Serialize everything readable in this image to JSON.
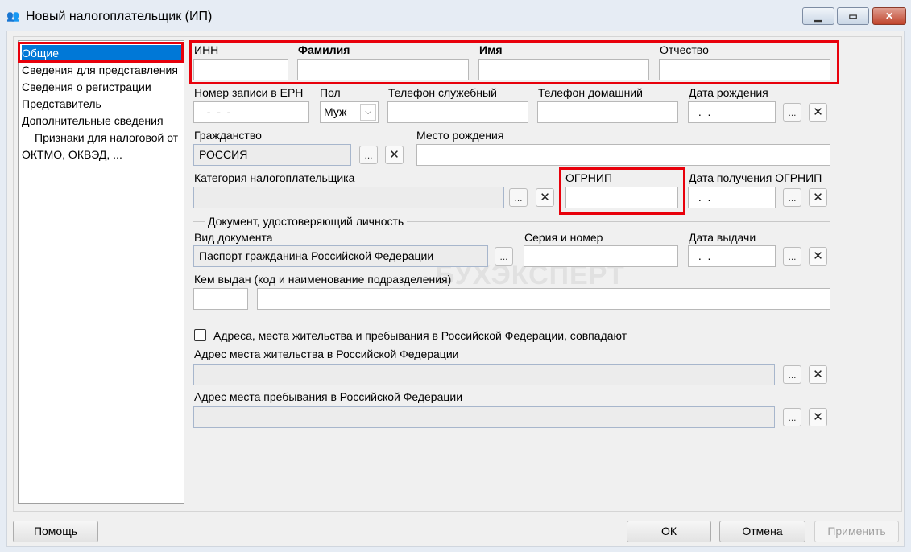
{
  "window": {
    "title": "Новый налогоплательщик (ИП)",
    "icon": "users-icon",
    "minimize": "▁",
    "maximize": "▭",
    "close": "✕"
  },
  "nav": {
    "items": [
      {
        "label": "Общие",
        "selected": true
      },
      {
        "label": "Сведения для представления"
      },
      {
        "label": "Сведения о регистрации"
      },
      {
        "label": "Представитель"
      },
      {
        "label": "Дополнительные сведения"
      },
      {
        "label": "Признаки для налоговой от"
      },
      {
        "label": "ОКТМО, ОКВЭД, ..."
      }
    ]
  },
  "form": {
    "inn": {
      "label": "ИНН",
      "value": ""
    },
    "surname": {
      "label": "Фамилия",
      "value": ""
    },
    "name": {
      "label": "Имя",
      "value": ""
    },
    "patronymic": {
      "label": "Отчество",
      "value": ""
    },
    "ern": {
      "label": "Номер записи в ЕРН",
      "value": "  -  -  -"
    },
    "sex": {
      "label": "Пол",
      "value": "Муж"
    },
    "phone_work": {
      "label": "Телефон служебный",
      "value": ""
    },
    "phone_home": {
      "label": "Телефон домашний",
      "value": ""
    },
    "birth_date": {
      "label": "Дата рождения",
      "value": " .  ."
    },
    "citizenship": {
      "label": "Гражданство",
      "value": "РОССИЯ"
    },
    "birth_place": {
      "label": "Место рождения",
      "value": ""
    },
    "category": {
      "label": "Категория налогоплательщика",
      "value": ""
    },
    "ogrnip": {
      "label": "ОГРНИП",
      "value": ""
    },
    "ogrnip_date": {
      "label": "Дата получения ОГРНИП",
      "value": " .  ."
    },
    "doc_section": "Документ, удостоверяющий личность",
    "doc_type": {
      "label": "Вид документа",
      "value": "Паспорт гражданина Российской Федерации"
    },
    "doc_number": {
      "label": "Серия и номер",
      "value": ""
    },
    "doc_date": {
      "label": "Дата выдачи",
      "value": " .  ."
    },
    "issued_by": {
      "label": "Кем выдан (код и наименование подразделения)",
      "code": "",
      "value": ""
    },
    "addr_same": {
      "label": "Адреса, места жительства и пребывания в Российской Федерации, совпадают",
      "checked": false
    },
    "addr_residence": {
      "label": "Адрес места жительства в Российской Федерации",
      "value": ""
    },
    "addr_stay": {
      "label": "Адрес места пребывания в Российской Федерации",
      "value": ""
    },
    "browse": "...",
    "clear": "✕"
  },
  "buttons": {
    "help": "Помощь",
    "ok": "ОК",
    "cancel": "Отмена",
    "apply": "Применить"
  },
  "watermark": "БУХЭКСПЕРТ",
  "colors": {
    "selection": "#0078d7",
    "highlight": "#e8000b"
  }
}
